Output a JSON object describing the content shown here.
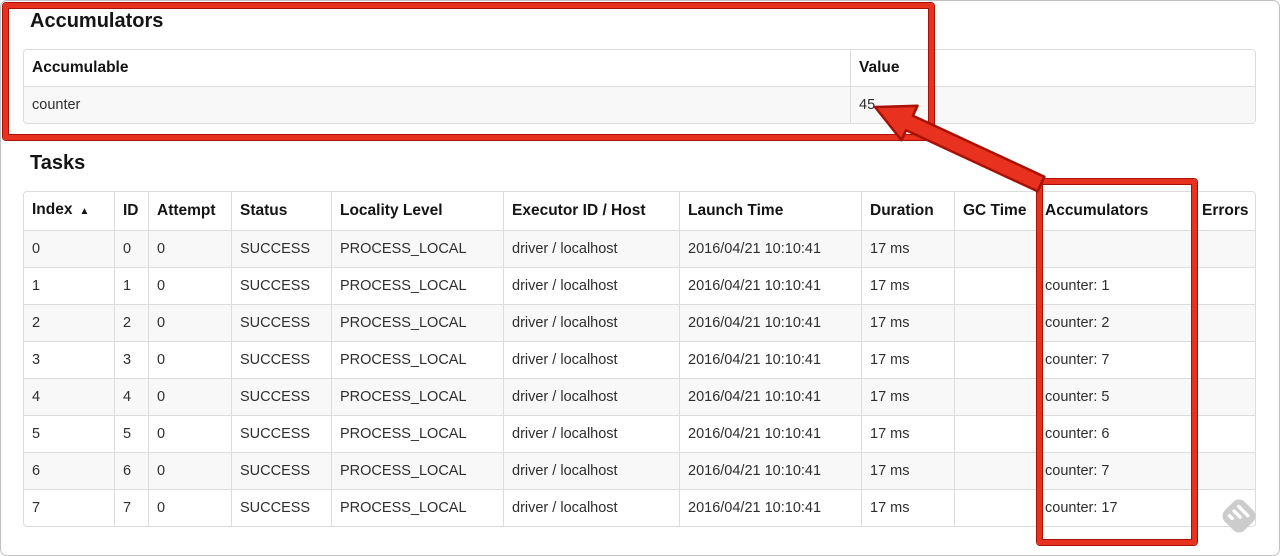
{
  "annotation": {
    "box_color": "#e8321f",
    "edge_color": "#a81106"
  },
  "accumulators_section": {
    "title": "Accumulators",
    "table": {
      "headers": [
        "Accumulable",
        "Value"
      ],
      "rows": [
        [
          "counter",
          "45"
        ]
      ]
    }
  },
  "tasks_section": {
    "title": "Tasks",
    "table": {
      "sort_icon": "▲",
      "headers": [
        "Index",
        "ID",
        "Attempt",
        "Status",
        "Locality Level",
        "Executor ID / Host",
        "Launch Time",
        "Duration",
        "GC Time",
        "Accumulators",
        "Errors"
      ],
      "rows": [
        [
          "0",
          "0",
          "0",
          "SUCCESS",
          "PROCESS_LOCAL",
          "driver / localhost",
          "2016/04/21 10:10:41",
          "17 ms",
          "",
          "",
          ""
        ],
        [
          "1",
          "1",
          "0",
          "SUCCESS",
          "PROCESS_LOCAL",
          "driver / localhost",
          "2016/04/21 10:10:41",
          "17 ms",
          "",
          "counter: 1",
          ""
        ],
        [
          "2",
          "2",
          "0",
          "SUCCESS",
          "PROCESS_LOCAL",
          "driver / localhost",
          "2016/04/21 10:10:41",
          "17 ms",
          "",
          "counter: 2",
          ""
        ],
        [
          "3",
          "3",
          "0",
          "SUCCESS",
          "PROCESS_LOCAL",
          "driver / localhost",
          "2016/04/21 10:10:41",
          "17 ms",
          "",
          "counter: 7",
          ""
        ],
        [
          "4",
          "4",
          "0",
          "SUCCESS",
          "PROCESS_LOCAL",
          "driver / localhost",
          "2016/04/21 10:10:41",
          "17 ms",
          "",
          "counter: 5",
          ""
        ],
        [
          "5",
          "5",
          "0",
          "SUCCESS",
          "PROCESS_LOCAL",
          "driver / localhost",
          "2016/04/21 10:10:41",
          "17 ms",
          "",
          "counter: 6",
          ""
        ],
        [
          "6",
          "6",
          "0",
          "SUCCESS",
          "PROCESS_LOCAL",
          "driver / localhost",
          "2016/04/21 10:10:41",
          "17 ms",
          "",
          "counter: 7",
          ""
        ],
        [
          "7",
          "7",
          "0",
          "SUCCESS",
          "PROCESS_LOCAL",
          "driver / localhost",
          "2016/04/21 10:10:41",
          "17 ms",
          "",
          "counter: 17",
          ""
        ]
      ]
    }
  }
}
